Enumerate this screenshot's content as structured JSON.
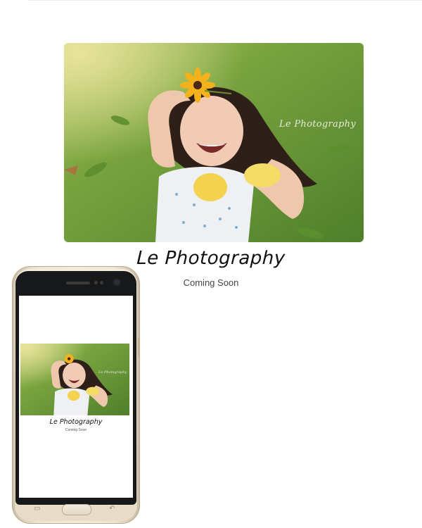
{
  "site": {
    "title": "Le Photography",
    "tagline": "Coming Soon",
    "watermark": "Le Photography"
  },
  "colors": {
    "grass": "#6f9a3c",
    "grass_light": "#a6c36a",
    "background": "#ffffff",
    "phone_body": "#efe5d4",
    "phone_face": "#17181a"
  },
  "icons": {
    "recent_apps": "recent-apps-icon",
    "back": "back-icon"
  }
}
